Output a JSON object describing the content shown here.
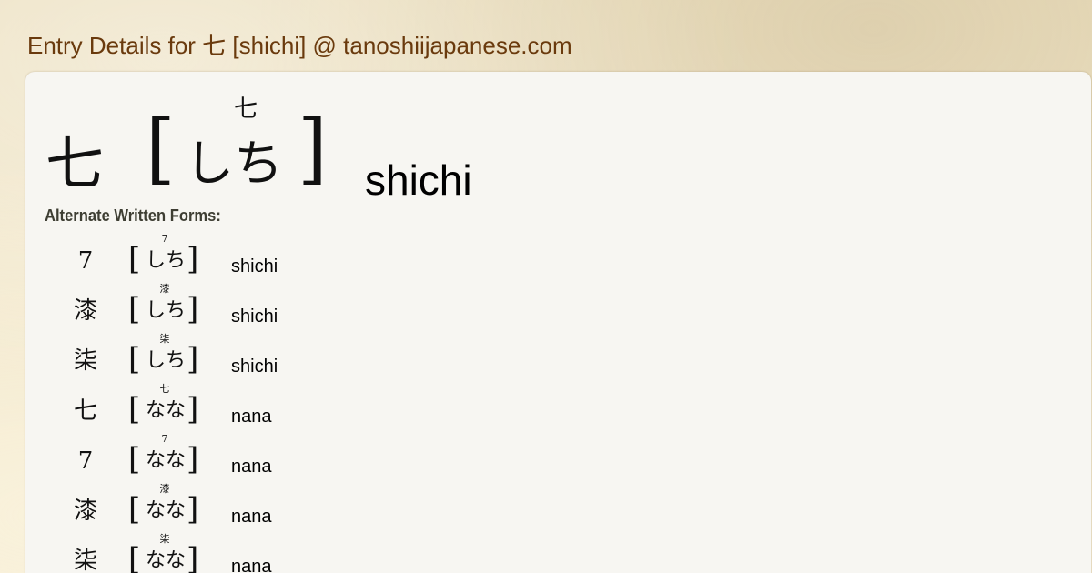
{
  "header": {
    "title": "Entry Details for 七 [shichi] @ tanoshiijapanese.com"
  },
  "entry": {
    "kanji": "七",
    "bracket_open": "[",
    "bracket_close": "]",
    "kana": "しち",
    "furigana": "七",
    "romaji": "shichi"
  },
  "alternates": {
    "heading": "Alternate Written Forms:",
    "items": [
      {
        "kanji": "7",
        "furigana": "7",
        "kana": "しち",
        "romaji": "shichi"
      },
      {
        "kanji": "漆",
        "furigana": "漆",
        "kana": "しち",
        "romaji": "shichi"
      },
      {
        "kanji": "柒",
        "furigana": "柒",
        "kana": "しち",
        "romaji": "shichi"
      },
      {
        "kanji": "七",
        "furigana": "七",
        "kana": "なな",
        "romaji": "nana"
      },
      {
        "kanji": "7",
        "furigana": "7",
        "kana": "なな",
        "romaji": "nana"
      },
      {
        "kanji": "漆",
        "furigana": "漆",
        "kana": "なな",
        "romaji": "nana"
      },
      {
        "kanji": "柒",
        "furigana": "柒",
        "kana": "なな",
        "romaji": "nana"
      }
    ]
  },
  "colors": {
    "title": "#6a3a0d",
    "card_background": "#f7f6f2",
    "page_background": "#efe3c4"
  }
}
